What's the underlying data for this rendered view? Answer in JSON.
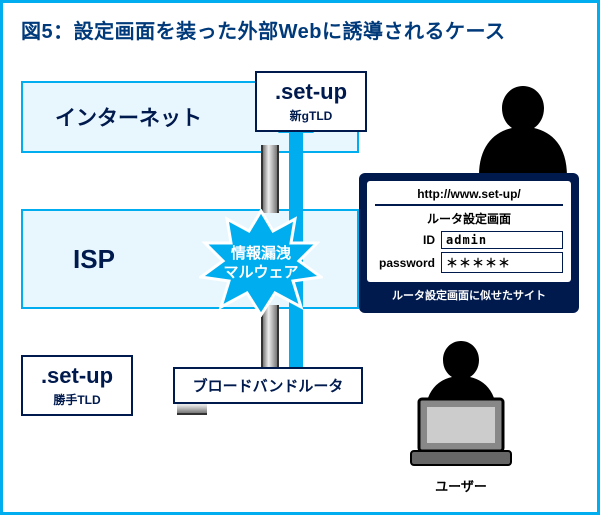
{
  "title": "図5：設定画面を装った外部Webに誘導されるケース",
  "tiers": {
    "internet": "インターネット",
    "isp": "ISP"
  },
  "setup_new": {
    "big": ".set-up",
    "small": "新gTLD"
  },
  "setup_fake": {
    "big": ".set-up",
    "small": "勝手TLD"
  },
  "router": "ブロードバンドルータ",
  "burst": {
    "line1": "情報漏洩",
    "line2": "マルウェア"
  },
  "attacker_panel": {
    "url": "http://www.set-up/",
    "header": "ルータ設定画面",
    "id_label": "ID",
    "id_value": "admin",
    "pw_label": "password",
    "pw_value": "＊＊＊＊＊",
    "caption": "ルータ設定画面に似せたサイト"
  },
  "user_label": "ユーザー"
}
